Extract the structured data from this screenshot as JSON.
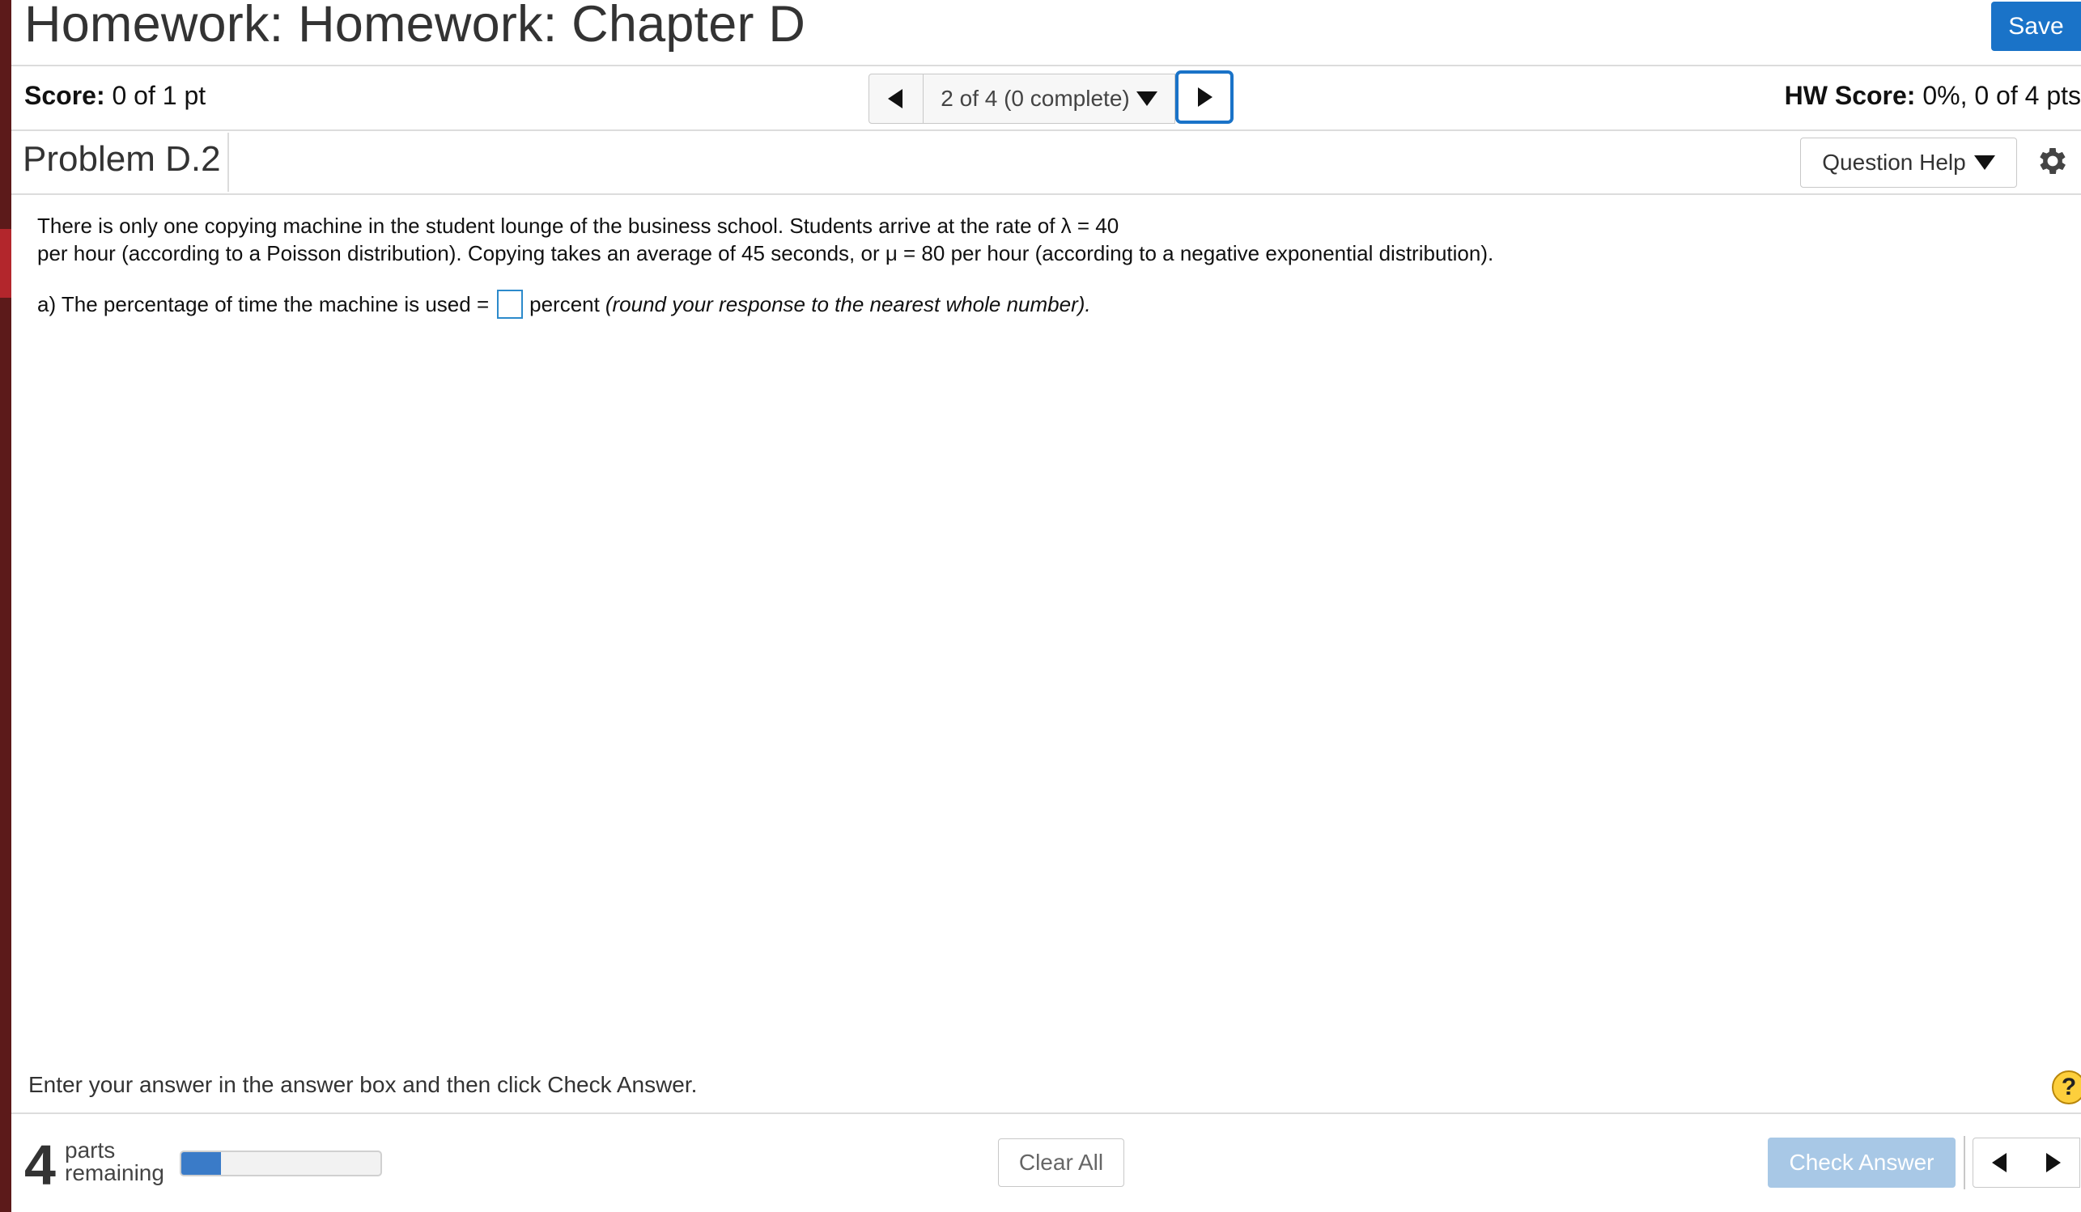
{
  "header": {
    "title": "Homework: Homework: Chapter D",
    "save_label": "Save"
  },
  "score_bar": {
    "score_label": "Score:",
    "score_value": "0 of 1 pt",
    "question_selector": "2 of 4 (0 complete)",
    "hw_score_label": "HW Score:",
    "hw_score_value": "0%, 0 of 4 pts"
  },
  "problem": {
    "title": "Problem D.2",
    "question_help_label": "Question Help",
    "text_line1": "There is only one copying machine in the student lounge of the business school. Students arrive at the rate of λ = 40",
    "text_line2": "per hour (according to a Poisson distribution).  Copying takes an average of 45 seconds, or μ = 80 per hour (according to a negative exponential distribution).",
    "part_a_prefix": "a) The percentage of time the machine is used =",
    "part_a_answer": "",
    "part_a_suffix": "percent",
    "part_a_hint": "(round your response to the nearest whole number)."
  },
  "footer": {
    "instruction": "Enter your answer in the answer box and then click Check Answer.",
    "help_symbol": "?",
    "parts_count": "4",
    "parts_label_line1": "parts",
    "parts_label_line2": "remaining",
    "progress_fraction": 0.2,
    "clear_all_label": "Clear All",
    "check_answer_label": "Check Answer"
  },
  "icons": {
    "prev": "triangle-left-icon",
    "next": "triangle-right-icon",
    "dropdown": "caret-down-icon",
    "settings": "gear-icon",
    "help": "help-circle-icon"
  },
  "colors": {
    "primary": "#1a73c8",
    "check_answer_disabled": "#a8c8e6",
    "progress_fill": "#3a7bc8",
    "help_circle": "#fdcf3c",
    "sidebar_accent": "#b3262c"
  }
}
